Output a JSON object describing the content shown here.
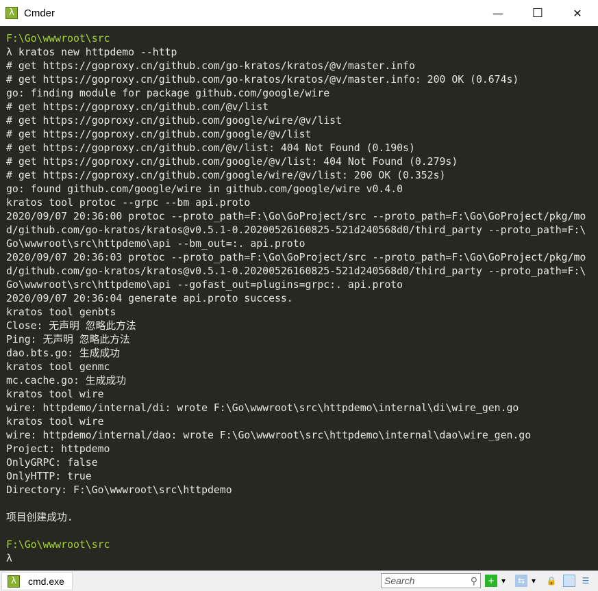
{
  "window": {
    "title": "Cmder",
    "minimize": "—",
    "maximize": "☐",
    "close": "✕",
    "app_icon": "λ"
  },
  "terminal": {
    "lines": [
      {
        "text": "F:\\Go\\wwwroot\\src",
        "prompt": true
      },
      {
        "text": "λ kratos new httpdemo --http"
      },
      {
        "text": "# get https://goproxy.cn/github.com/go-kratos/kratos/@v/master.info"
      },
      {
        "text": "# get https://goproxy.cn/github.com/go-kratos/kratos/@v/master.info: 200 OK (0.674s)"
      },
      {
        "text": "go: finding module for package github.com/google/wire"
      },
      {
        "text": "# get https://goproxy.cn/github.com/@v/list"
      },
      {
        "text": "# get https://goproxy.cn/github.com/google/wire/@v/list"
      },
      {
        "text": "# get https://goproxy.cn/github.com/google/@v/list"
      },
      {
        "text": "# get https://goproxy.cn/github.com/@v/list: 404 Not Found (0.190s)"
      },
      {
        "text": "# get https://goproxy.cn/github.com/google/@v/list: 404 Not Found (0.279s)"
      },
      {
        "text": "# get https://goproxy.cn/github.com/google/wire/@v/list: 200 OK (0.352s)"
      },
      {
        "text": "go: found github.com/google/wire in github.com/google/wire v0.4.0"
      },
      {
        "text": "kratos tool protoc --grpc --bm api.proto"
      },
      {
        "text": "2020/09/07 20:36:00 protoc --proto_path=F:\\Go\\GoProject/src --proto_path=F:\\Go\\GoProject/pkg/mo"
      },
      {
        "text": "d/github.com/go-kratos/kratos@v0.5.1-0.20200526160825-521d240568d0/third_party --proto_path=F:\\"
      },
      {
        "text": "Go\\wwwroot\\src\\httpdemo\\api --bm_out=:. api.proto"
      },
      {
        "text": "2020/09/07 20:36:03 protoc --proto_path=F:\\Go\\GoProject/src --proto_path=F:\\Go\\GoProject/pkg/mo"
      },
      {
        "text": "d/github.com/go-kratos/kratos@v0.5.1-0.20200526160825-521d240568d0/third_party --proto_path=F:\\"
      },
      {
        "text": "Go\\wwwroot\\src\\httpdemo\\api --gofast_out=plugins=grpc:. api.proto"
      },
      {
        "text": "2020/09/07 20:36:04 generate api.proto success."
      },
      {
        "text": "kratos tool genbts"
      },
      {
        "text": "Close: 无声明 忽略此方法"
      },
      {
        "text": "Ping: 无声明 忽略此方法"
      },
      {
        "text": "dao.bts.go: 生成成功"
      },
      {
        "text": "kratos tool genmc"
      },
      {
        "text": "mc.cache.go: 生成成功"
      },
      {
        "text": "kratos tool wire"
      },
      {
        "text": "wire: httpdemo/internal/di: wrote F:\\Go\\wwwroot\\src\\httpdemo\\internal\\di\\wire_gen.go"
      },
      {
        "text": "kratos tool wire"
      },
      {
        "text": "wire: httpdemo/internal/dao: wrote F:\\Go\\wwwroot\\src\\httpdemo\\internal\\dao\\wire_gen.go"
      },
      {
        "text": "Project: httpdemo"
      },
      {
        "text": "OnlyGRPC: false"
      },
      {
        "text": "OnlyHTTP: true"
      },
      {
        "text": "Directory: F:\\Go\\wwwroot\\src\\httpdemo"
      },
      {
        "text": ""
      },
      {
        "text": "项目创建成功."
      },
      {
        "text": ""
      },
      {
        "text": "F:\\Go\\wwwroot\\src",
        "prompt": true
      },
      {
        "text": "λ"
      }
    ]
  },
  "statusbar": {
    "tab_label": "cmd.exe",
    "search_placeholder": "Search"
  },
  "colors": {
    "background": "#272822",
    "prompt": "#a6d530",
    "text": "#e8e8e0"
  }
}
